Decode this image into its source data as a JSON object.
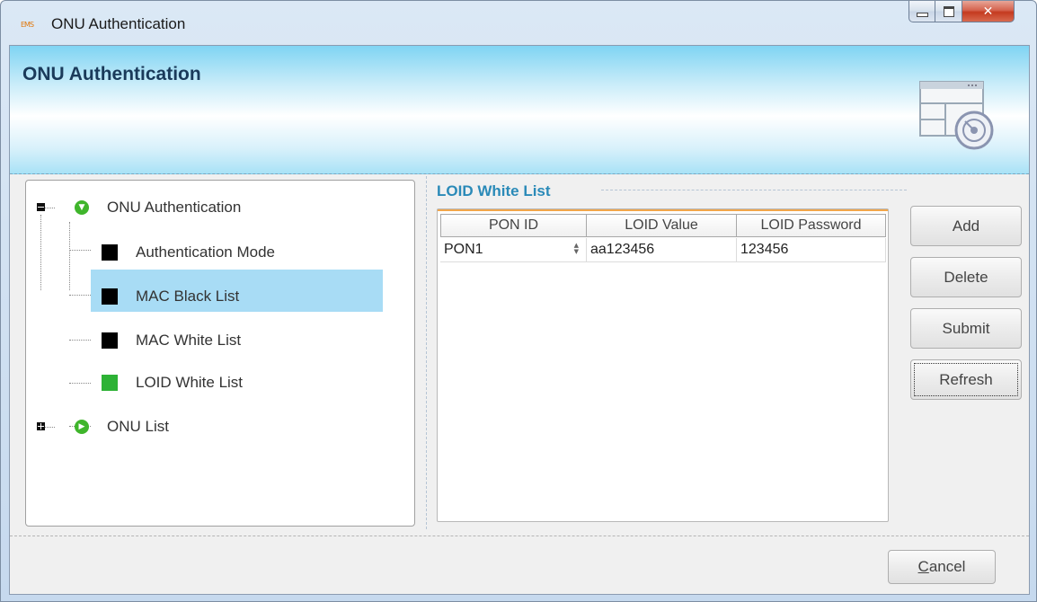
{
  "window": {
    "title": "ONU Authentication",
    "app_icon_text": "EMS"
  },
  "banner": {
    "title": "ONU Authentication"
  },
  "tree": {
    "root": {
      "label": "ONU Authentication",
      "expanded": true,
      "children": [
        {
          "label": "Authentication Mode",
          "icon_color": "#000000"
        },
        {
          "label": "MAC Black List",
          "icon_color": "#000000"
        },
        {
          "label": "MAC White List",
          "icon_color": "#000000"
        },
        {
          "label": "LOID White List",
          "icon_color": "#2db235",
          "selected": true
        }
      ]
    },
    "second": {
      "label": "ONU List",
      "expanded": false
    }
  },
  "section": {
    "title": "LOID White List"
  },
  "table": {
    "columns": [
      "PON ID",
      "LOID Value",
      "LOID Password"
    ],
    "rows": [
      {
        "pon_id": "PON1",
        "loid_value": "aa123456",
        "loid_password": "123456"
      }
    ]
  },
  "buttons": {
    "add": "Add",
    "delete": "Delete",
    "submit": "Submit",
    "refresh": "Refresh",
    "cancel_mnemonic": "C",
    "cancel_rest": "ancel"
  },
  "colors": {
    "section_title": "#2a8ab8",
    "selection": "#a8dcf5",
    "tree_node_green": "#3fb52b",
    "table_header_accent": "#f2a64a"
  }
}
